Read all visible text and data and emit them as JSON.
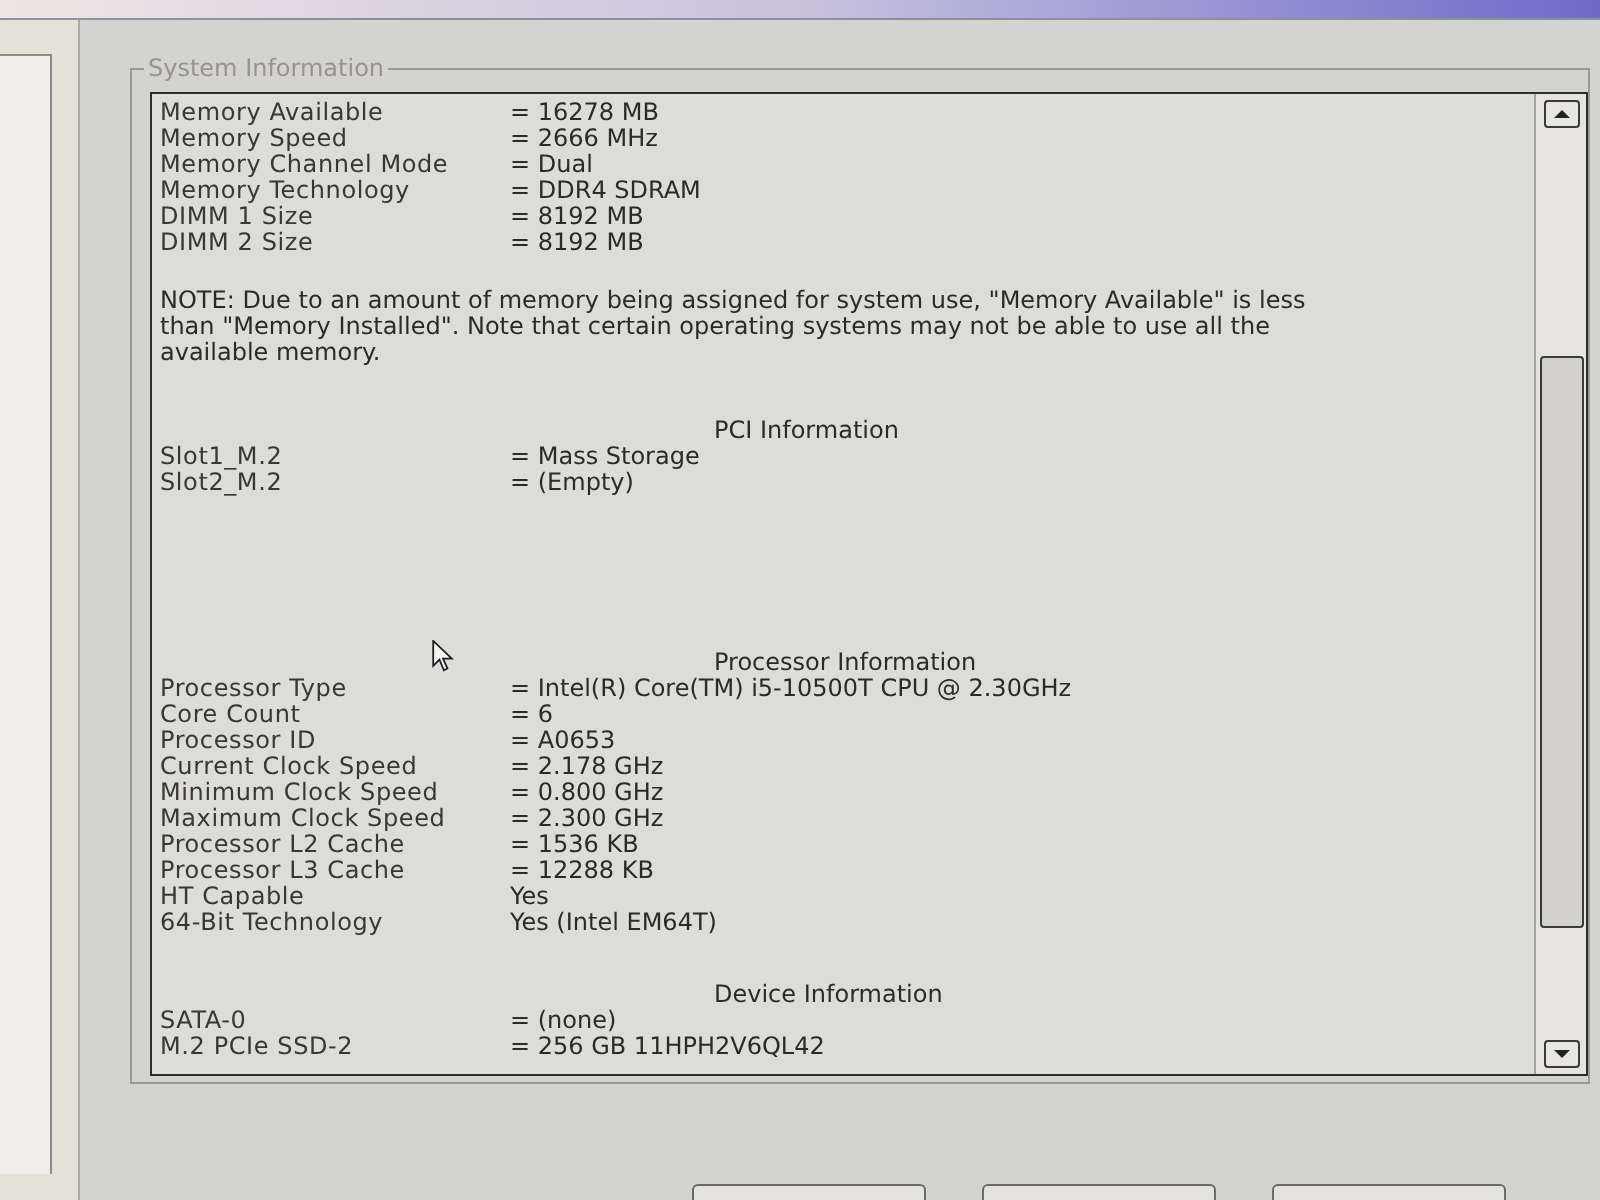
{
  "group": {
    "title": "System Information",
    "blocks": [
      {
        "kind": "fields",
        "rows": [
          {
            "label": "Memory Available",
            "value": "= 16278 MB"
          },
          {
            "label": "Memory Speed",
            "value": "= 2666 MHz"
          },
          {
            "label": "Memory Channel Mode",
            "value": "= Dual"
          },
          {
            "label": "Memory Technology",
            "value": "= DDR4 SDRAM"
          },
          {
            "label": "DIMM 1 Size",
            "value": "= 8192 MB"
          },
          {
            "label": "DIMM 2 Size",
            "value": "= 8192 MB"
          }
        ]
      },
      {
        "kind": "note",
        "text": "NOTE: Due to an amount of memory being assigned for system use, \"Memory Available\" is less than \"Memory Installed\". Note that certain operating systems may not be able to use all the available memory."
      },
      {
        "kind": "fields",
        "heading": "PCI Information",
        "rows": [
          {
            "label": "Slot1_M.2",
            "value": "= Mass Storage"
          },
          {
            "label": "Slot2_M.2",
            "value": "= (Empty)"
          }
        ]
      },
      {
        "kind": "fields",
        "heading": "Processor Information",
        "rows": [
          {
            "label": "Processor Type",
            "value": "= Intel(R) Core(TM) i5-10500T CPU @ 2.30GHz"
          },
          {
            "label": "Core Count",
            "value": "= 6"
          },
          {
            "label": "Processor ID",
            "value": "= A0653"
          },
          {
            "label": "Current Clock Speed",
            "value": "= 2.178 GHz"
          },
          {
            "label": "Minimum Clock Speed",
            "value": "= 0.800 GHz"
          },
          {
            "label": "Maximum Clock Speed",
            "value": "= 2.300 GHz"
          },
          {
            "label": "Processor L2 Cache",
            "value": "= 1536 KB"
          },
          {
            "label": "Processor L3 Cache",
            "value": "= 12288 KB"
          },
          {
            "label": "HT Capable",
            "value": "Yes"
          },
          {
            "label": "64-Bit Technology",
            "value": "Yes (Intel EM64T)"
          }
        ]
      },
      {
        "kind": "fields",
        "heading": "Device Information",
        "rows": [
          {
            "label": "SATA-0",
            "value": "= (none)"
          },
          {
            "label": "M.2 PCIe SSD-2",
            "value": "= 256 GB 11HPH2V6QL42"
          }
        ]
      }
    ]
  }
}
